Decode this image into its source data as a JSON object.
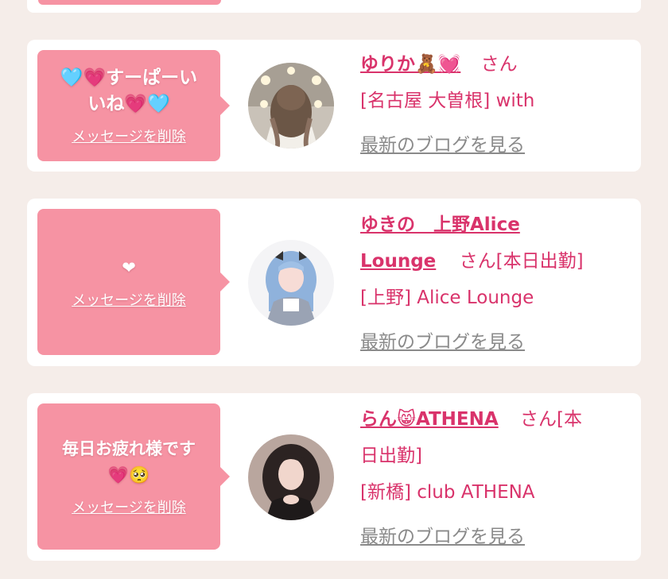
{
  "cards": [
    {
      "message_lines": [
        "🩵💗すーぱーい",
        "いね💗🩵"
      ],
      "delete_label": "メッセージを削除",
      "avatar_icon": "girl-back-hair-photo",
      "name": "ゆりか🧸💓",
      "san": "さん",
      "shop_line": "[名古屋 大曽根] with",
      "blog_label": "最新のブログを見る"
    },
    {
      "message_lines": [
        "❤"
      ],
      "delete_label": "メッセージを削除",
      "avatar_icon": "girl-blue-hair-photo",
      "name_line1": "ゆきの　上野Alice",
      "name_line2": "Lounge",
      "san_status": "さん[本日出勤]",
      "shop_line": "[上野] Alice Lounge",
      "blog_label": "最新のブログを見る"
    },
    {
      "message_lines": [
        "毎日お疲れ様です",
        "💗🥺"
      ],
      "delete_label": "メッセージを削除",
      "avatar_icon": "girl-dark-hair-photo",
      "name": "らん😸ATHENA",
      "san_status_1": "さん[本",
      "san_status_2": "日出勤]",
      "shop_line": "[新橋] club ATHENA",
      "blog_label": "最新のブログを見る"
    }
  ],
  "colors": {
    "page_bg": "#f5ede9",
    "bubble_pink": "#f693a3",
    "accent": "#d9336b",
    "blog_gray": "#8a8a8a"
  }
}
